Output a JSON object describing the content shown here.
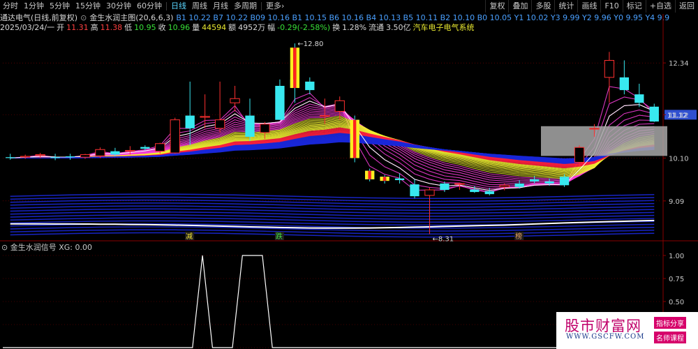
{
  "toolbar": {
    "periods": [
      "分时",
      "1分钟",
      "5分钟",
      "15分钟",
      "30分钟",
      "60分钟",
      "日线",
      "周线",
      "月线",
      "多周期",
      "更多›"
    ],
    "active_period": "日线",
    "right": [
      "复权",
      "叠加",
      "多股",
      "统计",
      "画线",
      "F10",
      "标记",
      "+自选",
      "返回"
    ]
  },
  "info": {
    "stock_name": "通达电气(日线,前复权)",
    "indicator": "金生水润主图(20,6,6,3)",
    "indicator_values": "B1 10.22  B7 10.22  B09 10.16  B1 10.15  B6 10.16  B4 10.13  B5 10.11  B2 10.10  B0 10.05  Y1 10.02  Y3 9.99  Y2 9.96  Y0 9.95  Y4 9.9",
    "date": "2025/03/24/一",
    "open_label": "开",
    "open": "11.31",
    "high_label": "高",
    "high": "11.38",
    "low_label": "低",
    "low": "10.95",
    "close_label": "收",
    "close": "10.96",
    "volume_label": "量",
    "volume": "44594",
    "amount_label": "额",
    "amount": "4952万",
    "change_label": "幅",
    "change": "-0.29(-2.58%)",
    "turnover_label": "换",
    "turnover": "1.28%",
    "float_label": "流通",
    "float_value": "3.50亿",
    "sector": "汽车电子电气系统"
  },
  "annotations": {
    "high_mark": "12.80",
    "low_mark": "8.31",
    "current_price": "11.12",
    "signal_1": "减",
    "signal_2": "跌",
    "signal_3": "榜"
  },
  "sub_indicator": {
    "title": "金生水润信号",
    "value_label": "XG: 0.00"
  },
  "watermark": {
    "brand": "股市财富网",
    "url": "WWW.GSCFW.COM",
    "tag1": "指标分享",
    "tag2": "名师课程"
  },
  "colors": {
    "up": "#ff3030",
    "down": "#38e8f0",
    "ribbon_blue": "#1a28d8",
    "ribbon_red": "#ff2040",
    "ribbon_yellow": "#f0f030",
    "ribbon_magenta": "#ff40e0",
    "grid": "#8a0000"
  },
  "chart_data": [
    {
      "type": "candlestick",
      "title": "",
      "ylim": [
        8.2,
        13.0
      ],
      "yticks": [
        9.09,
        10.1,
        11.12,
        12.34
      ],
      "candles": [
        {
          "o": 10.12,
          "h": 10.2,
          "l": 10.06,
          "c": 10.1
        },
        {
          "o": 10.12,
          "h": 10.18,
          "l": 10.08,
          "c": 10.14
        },
        {
          "o": 10.16,
          "h": 10.22,
          "l": 10.1,
          "c": 10.18
        },
        {
          "o": 10.12,
          "h": 10.2,
          "l": 10.05,
          "c": 10.1
        },
        {
          "o": 10.14,
          "h": 10.2,
          "l": 10.06,
          "c": 10.12
        },
        {
          "o": 10.12,
          "h": 10.2,
          "l": 10.08,
          "c": 10.18
        },
        {
          "o": 10.15,
          "h": 10.35,
          "l": 10.1,
          "c": 10.3
        },
        {
          "o": 10.26,
          "h": 10.34,
          "l": 10.14,
          "c": 10.18
        },
        {
          "o": 10.28,
          "h": 10.38,
          "l": 10.18,
          "c": 10.28
        },
        {
          "o": 10.36,
          "h": 10.4,
          "l": 10.28,
          "c": 10.32
        },
        {
          "o": 10.26,
          "h": 10.46,
          "l": 10.2,
          "c": 10.44
        },
        {
          "o": 10.22,
          "h": 11.05,
          "l": 10.2,
          "c": 11.0
        },
        {
          "o": 11.1,
          "h": 11.9,
          "l": 10.4,
          "c": 10.8
        },
        {
          "o": 11.06,
          "h": 11.6,
          "l": 10.8,
          "c": 11.08
        },
        {
          "o": 10.8,
          "h": 11.9,
          "l": 10.7,
          "c": 11.0
        },
        {
          "o": 11.4,
          "h": 11.8,
          "l": 11.2,
          "c": 11.5
        },
        {
          "o": 11.1,
          "h": 11.5,
          "l": 10.5,
          "c": 10.6
        },
        {
          "o": 10.7,
          "h": 10.95,
          "l": 10.55,
          "c": 10.9
        },
        {
          "o": 11.8,
          "h": 11.95,
          "l": 11.0,
          "c": 11.0
        },
        {
          "o": 11.95,
          "h": 12.8,
          "l": 11.4,
          "c": 11.75
        },
        {
          "o": 11.9,
          "h": 12.0,
          "l": 11.6,
          "c": 11.7
        },
        {
          "o": 11.08,
          "h": 11.5,
          "l": 10.9,
          "c": 11.1
        },
        {
          "o": 11.2,
          "h": 11.55,
          "l": 11.0,
          "c": 11.45
        },
        {
          "o": 11.0,
          "h": 11.1,
          "l": 10.0,
          "c": 10.1
        },
        {
          "o": 9.8,
          "h": 9.85,
          "l": 9.55,
          "c": 9.6
        },
        {
          "o": 9.66,
          "h": 9.7,
          "l": 9.5,
          "c": 9.62
        },
        {
          "o": 9.62,
          "h": 9.74,
          "l": 9.5,
          "c": 9.58
        },
        {
          "o": 9.48,
          "h": 9.6,
          "l": 9.15,
          "c": 9.2
        },
        {
          "o": 9.22,
          "h": 9.4,
          "l": 8.31,
          "c": 9.35
        },
        {
          "o": 9.5,
          "h": 9.55,
          "l": 9.3,
          "c": 9.35
        },
        {
          "o": 9.5,
          "h": 9.52,
          "l": 9.35,
          "c": 9.5
        },
        {
          "o": 9.36,
          "h": 9.44,
          "l": 9.28,
          "c": 9.3
        },
        {
          "o": 9.32,
          "h": 9.4,
          "l": 9.22,
          "c": 9.25
        },
        {
          "o": 9.42,
          "h": 9.5,
          "l": 9.34,
          "c": 9.46
        },
        {
          "o": 9.5,
          "h": 9.58,
          "l": 9.38,
          "c": 9.42
        },
        {
          "o": 9.6,
          "h": 9.68,
          "l": 9.5,
          "c": 9.55
        },
        {
          "o": 9.55,
          "h": 9.62,
          "l": 9.45,
          "c": 9.5
        },
        {
          "o": 9.66,
          "h": 9.72,
          "l": 9.42,
          "c": 9.46
        },
        {
          "o": 10.0,
          "h": 10.4,
          "l": 9.9,
          "c": 10.35
        },
        {
          "o": 10.8,
          "h": 10.9,
          "l": 10.6,
          "c": 10.8
        },
        {
          "o": 12.0,
          "h": 12.6,
          "l": 11.4,
          "c": 12.4
        },
        {
          "o": 12.0,
          "h": 12.4,
          "l": 11.6,
          "c": 11.7
        },
        {
          "o": 11.6,
          "h": 11.85,
          "l": 11.3,
          "c": 11.4
        },
        {
          "o": 11.31,
          "h": 11.38,
          "l": 10.95,
          "c": 10.96
        }
      ]
    },
    {
      "type": "line",
      "title": "",
      "ylim": [
        0,
        1.0
      ],
      "yticks": [
        0,
        0.25,
        0.5,
        0.75,
        1.0
      ],
      "series": [
        {
          "values": [
            0,
            0,
            0,
            0,
            0,
            0,
            0,
            0,
            0,
            0,
            0,
            0,
            0,
            0,
            0,
            0,
            0,
            0,
            0,
            0,
            1,
            0,
            0,
            0,
            1,
            1,
            1,
            0,
            0,
            0,
            0,
            0,
            0,
            0,
            0,
            0,
            0,
            0,
            0,
            0,
            0,
            0,
            0,
            0,
            0,
            0,
            0,
            0,
            0,
            0,
            0,
            0,
            0,
            0,
            0,
            0,
            0,
            0,
            0,
            0,
            0,
            0,
            0,
            0,
            0,
            0,
            0
          ]
        }
      ]
    }
  ]
}
